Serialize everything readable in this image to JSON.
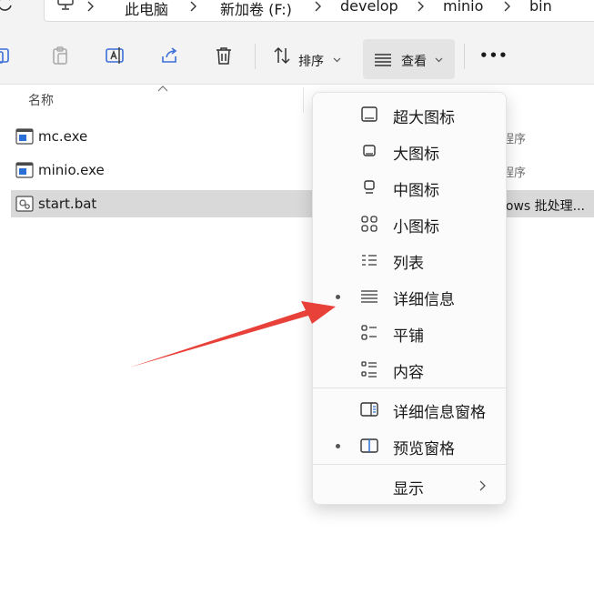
{
  "address_bar": {
    "segments": [
      "此电脑",
      "新加卷 (F:)",
      "develop",
      "minio",
      "bin"
    ]
  },
  "toolbar": {
    "sort_label": "排序",
    "view_label": "查看",
    "more_label": "•••"
  },
  "file_list": {
    "column_name": "名称",
    "files": [
      {
        "name": "mc.exe",
        "type": "程序",
        "selected": false
      },
      {
        "name": "minio.exe",
        "type": "程序",
        "selected": false
      },
      {
        "name": "start.bat",
        "type": "lows 批处理...",
        "selected": true
      }
    ]
  },
  "view_menu": {
    "items": [
      {
        "label": "超大图标",
        "icon": "extra-large-icons-icon",
        "checked": false
      },
      {
        "label": "大图标",
        "icon": "large-icons-icon",
        "checked": false
      },
      {
        "label": "中图标",
        "icon": "medium-icons-icon",
        "checked": false
      },
      {
        "label": "小图标",
        "icon": "small-icons-icon",
        "checked": false
      },
      {
        "label": "列表",
        "icon": "list-icon",
        "checked": false
      },
      {
        "label": "详细信息",
        "icon": "details-icon",
        "checked": true
      },
      {
        "label": "平铺",
        "icon": "tiles-icon",
        "checked": false
      },
      {
        "label": "内容",
        "icon": "content-icon",
        "checked": false
      }
    ],
    "pane_items": [
      {
        "label": "详细信息窗格",
        "icon": "details-pane-icon",
        "checked": false
      },
      {
        "label": "预览窗格",
        "icon": "preview-pane-icon",
        "checked": true
      }
    ],
    "show_label": "显示"
  },
  "colors": {
    "annotation_arrow": "#e8413a",
    "selected_row": "#d9d9d9",
    "toolbar_bg": "#f3f3f3"
  }
}
